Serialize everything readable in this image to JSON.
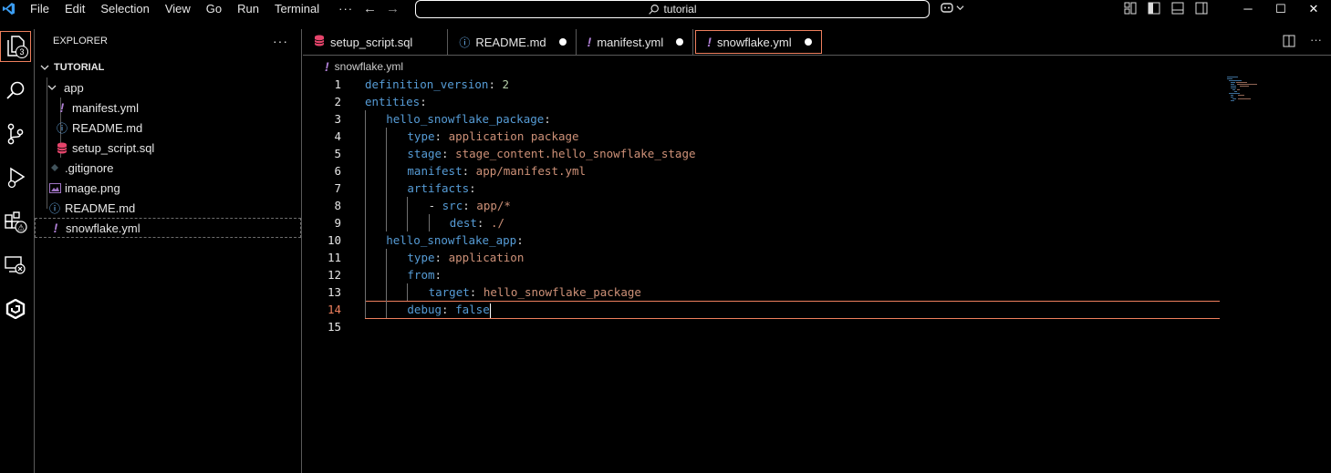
{
  "titlebar": {
    "menu": [
      "File",
      "Edit",
      "Selection",
      "View",
      "Go",
      "Run",
      "Terminal"
    ],
    "more": "···",
    "search": "tutorial"
  },
  "activity": {
    "explorer_badge": "3"
  },
  "sidebar": {
    "header": "EXPLORER",
    "more": "···",
    "root": "TUTORIAL",
    "folder": "app",
    "items": [
      {
        "name": "manifest.yml",
        "icon": "yaml-icon"
      },
      {
        "name": "README.md",
        "icon": "info-icon"
      },
      {
        "name": "setup_script.sql",
        "icon": "database-icon"
      },
      {
        "name": ".gitignore",
        "icon": "git-icon"
      },
      {
        "name": "image.png",
        "icon": "image-icon"
      },
      {
        "name": "README.md",
        "icon": "info-icon"
      },
      {
        "name": "snowflake.yml",
        "icon": "yaml-icon"
      }
    ]
  },
  "tabs": [
    {
      "label": "setup_script.sql",
      "dirty": false
    },
    {
      "label": "README.md",
      "dirty": true
    },
    {
      "label": "manifest.yml",
      "dirty": true
    },
    {
      "label": "snowflake.yml",
      "dirty": true,
      "active": true
    }
  ],
  "breadcrumb": "snowflake.yml",
  "code": {
    "current_line": 14,
    "lines": [
      {
        "n": "1",
        "parts": [
          [
            "k",
            "definition_version"
          ],
          [
            "p",
            ": "
          ],
          [
            "n",
            "2"
          ]
        ],
        "indent": 0
      },
      {
        "n": "2",
        "parts": [
          [
            "k",
            "entities"
          ],
          [
            "p",
            ":"
          ]
        ],
        "indent": 0
      },
      {
        "n": "3",
        "parts": [
          [
            "k",
            "hello_snowflake_package"
          ],
          [
            "p",
            ":"
          ]
        ],
        "indent": 1
      },
      {
        "n": "4",
        "parts": [
          [
            "k",
            "type"
          ],
          [
            "p",
            ": "
          ],
          [
            "s",
            "application package"
          ]
        ],
        "indent": 2
      },
      {
        "n": "5",
        "parts": [
          [
            "k",
            "stage"
          ],
          [
            "p",
            ": "
          ],
          [
            "s",
            "stage_content.hello_snowflake_stage"
          ]
        ],
        "indent": 2
      },
      {
        "n": "6",
        "parts": [
          [
            "k",
            "manifest"
          ],
          [
            "p",
            ": "
          ],
          [
            "s",
            "app/manifest.yml"
          ]
        ],
        "indent": 2
      },
      {
        "n": "7",
        "parts": [
          [
            "k",
            "artifacts"
          ],
          [
            "p",
            ":"
          ]
        ],
        "indent": 2
      },
      {
        "n": "8",
        "parts": [
          [
            "p",
            "- "
          ],
          [
            "k",
            "src"
          ],
          [
            "p",
            ": "
          ],
          [
            "s",
            "app/*"
          ]
        ],
        "indent": 3
      },
      {
        "n": "9",
        "parts": [
          [
            "k",
            "dest"
          ],
          [
            "p",
            ": "
          ],
          [
            "s",
            "./"
          ]
        ],
        "indent": 4
      },
      {
        "n": "10",
        "parts": [
          [
            "k",
            "hello_snowflake_app"
          ],
          [
            "p",
            ":"
          ]
        ],
        "indent": 1
      },
      {
        "n": "11",
        "parts": [
          [
            "k",
            "type"
          ],
          [
            "p",
            ": "
          ],
          [
            "s",
            "application"
          ]
        ],
        "indent": 2
      },
      {
        "n": "12",
        "parts": [
          [
            "k",
            "from"
          ],
          [
            "p",
            ":"
          ]
        ],
        "indent": 2
      },
      {
        "n": "13",
        "parts": [
          [
            "k",
            "target"
          ],
          [
            "p",
            ": "
          ],
          [
            "s",
            "hello_snowflake_package"
          ]
        ],
        "indent": 3
      },
      {
        "n": "14",
        "parts": [
          [
            "k",
            "debug"
          ],
          [
            "p",
            ": "
          ],
          [
            "b",
            "false"
          ]
        ],
        "indent": 2
      },
      {
        "n": "15",
        "parts": [],
        "indent": 0
      }
    ]
  }
}
